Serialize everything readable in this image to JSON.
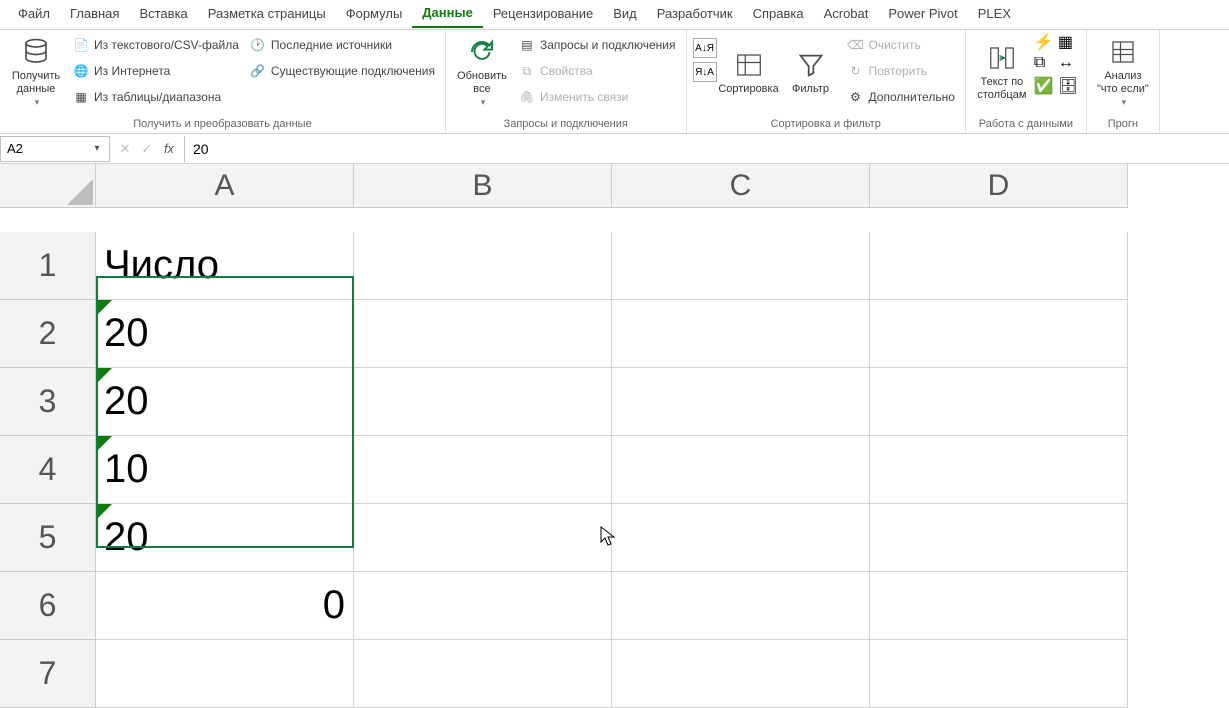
{
  "tabs": {
    "file": "Файл",
    "home": "Главная",
    "insert": "Вставка",
    "pagelayout": "Разметка страницы",
    "formulas": "Формулы",
    "data": "Данные",
    "review": "Рецензирование",
    "view": "Вид",
    "developer": "Разработчик",
    "help": "Справка",
    "acrobat": "Acrobat",
    "powerpivot": "Power Pivot",
    "plex": "PLEX"
  },
  "ribbon": {
    "getdata": {
      "btn": "Получить данные",
      "from_csv": "Из текстового/CSV-файла",
      "from_web": "Из Интернета",
      "from_table": "Из таблицы/диапазона",
      "recent": "Последние источники",
      "existing": "Существующие подключения",
      "group": "Получить и преобразовать данные"
    },
    "queries": {
      "refresh": "Обновить все",
      "qc": "Запросы и подключения",
      "props": "Свойства",
      "links": "Изменить связи",
      "group": "Запросы и подключения"
    },
    "sort": {
      "sort": "Сортировка",
      "filter": "Фильтр",
      "clear": "Очистить",
      "reapply": "Повторить",
      "advanced": "Дополнительно",
      "group": "Сортировка и фильтр"
    },
    "tools": {
      "ttc": "Текст по столбцам",
      "group": "Работа с данными"
    },
    "whatif": {
      "btn": "Анализ \"что если\"",
      "group": "Прогн"
    }
  },
  "fbar": {
    "ref": "A2",
    "formula": "20"
  },
  "cols": [
    "A",
    "B",
    "C",
    "D"
  ],
  "rows": [
    "1",
    "2",
    "3",
    "4",
    "5",
    "6",
    "7"
  ],
  "cells": {
    "A1": "Число",
    "A2": "20",
    "A3": "20",
    "A4": "10",
    "A5": "20",
    "A6": "0"
  }
}
